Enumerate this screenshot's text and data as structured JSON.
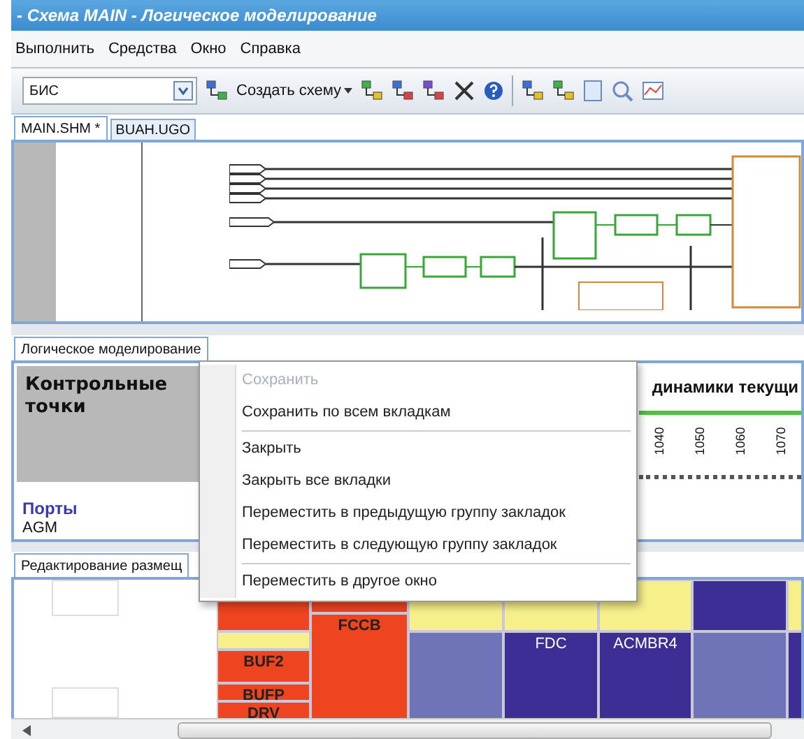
{
  "window": {
    "title": "- Схема MAIN - Логическое моделирование"
  },
  "menu": [
    "Выполнить",
    "Средства",
    "Окно",
    "Справка"
  ],
  "toolbar": {
    "combo": {
      "value": "БИС"
    },
    "create_button": "Создать схему"
  },
  "document_tabs": [
    {
      "label": "MAIN.SHM *",
      "selected": true
    },
    {
      "label": "BUAH.UGO",
      "selected": false
    }
  ],
  "simulation_panel": {
    "tab": "Логическое моделирование",
    "checkpoints_title": "Контрольные точки",
    "ports_heading": "Порты",
    "port": "AGM",
    "chart_heading": "динамики текущи",
    "ticks": [
      "1040",
      "1050",
      "1060",
      "1070"
    ]
  },
  "context_menu": [
    {
      "label": "Сохранить",
      "disabled": true,
      "separator_before": false
    },
    {
      "label": "Сохранить по всем вкладкам",
      "disabled": false,
      "separator_before": false
    },
    {
      "label": "Закрыть",
      "disabled": false,
      "separator_before": true
    },
    {
      "label": "Закрыть все вкладки",
      "disabled": false,
      "separator_before": false
    },
    {
      "label": "Переместить в предыдущую группу закладок",
      "disabled": false,
      "separator_before": false
    },
    {
      "label": "Переместить в следующую группу закладок",
      "disabled": false,
      "separator_before": false
    },
    {
      "label": "Переместить в другое окно",
      "disabled": false,
      "separator_before": true
    }
  ],
  "placement_panel": {
    "tab": "Редактирование размещ",
    "columns": [
      [
        {
          "color": "#ee4420"
        },
        {
          "color": "#f6ef8a"
        },
        {
          "color": "#ee4420",
          "label": "BUF2"
        },
        {
          "color": "#ee4420",
          "label": "BUFP"
        },
        {
          "color": "#ee4420",
          "label": "DRV"
        }
      ],
      [
        {
          "color": "#ee4420"
        },
        {
          "color": "#ee4420",
          "label": "FCCB"
        }
      ],
      [
        {
          "color": "#f6ef8a"
        },
        {
          "color": "#6f73b8"
        }
      ],
      [
        {
          "color": "#f6ef8a"
        },
        {
          "color": "#3d2e95",
          "label": "FDC"
        }
      ],
      [
        {
          "color": "#f6ef8a"
        },
        {
          "color": "#3d2e95",
          "label": "ACMBR4"
        }
      ],
      [
        {
          "color": "#3d2e95"
        },
        {
          "color": "#6f73b8"
        }
      ],
      [
        {
          "color": "#f6ef8a"
        },
        {
          "color": "#3d2e95"
        }
      ]
    ]
  }
}
